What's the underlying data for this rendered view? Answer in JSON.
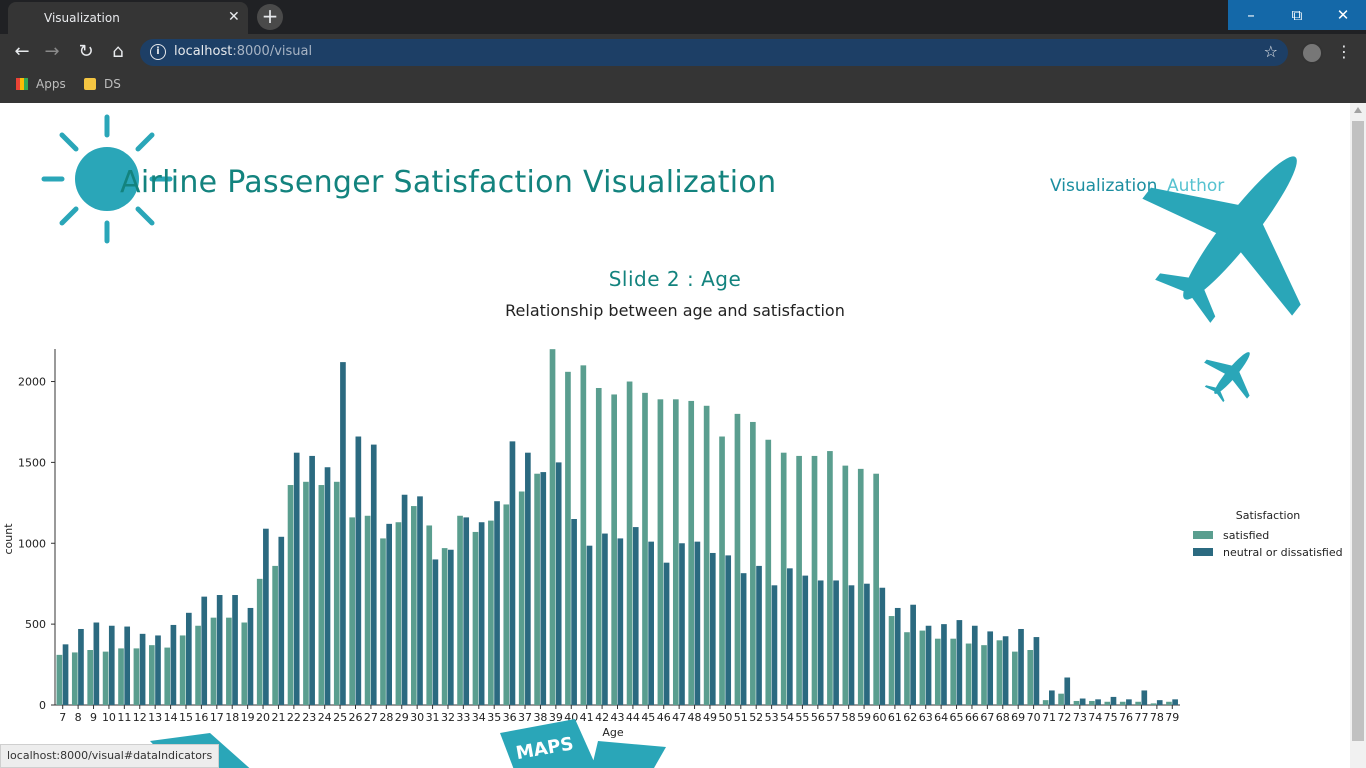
{
  "browser": {
    "tab_title": "Visualization",
    "url_host": "localhost",
    "url_rest": ":8000/visual",
    "bookmarks": [
      "Apps",
      "DS"
    ],
    "status_url": "localhost:8000/visual#dataIndicators"
  },
  "site": {
    "title": "Airline Passenger Satisfaction Visualization",
    "nav": [
      "Visualization",
      "Author"
    ]
  },
  "slide": {
    "title": "Slide 2 : Age",
    "subtitle": "Relationship between age and satisfaction"
  },
  "decor": {
    "bottom_sign": "MAPS"
  },
  "colors": {
    "satisfied": "#5a9e8f",
    "neutral": "#2b6a80",
    "accent": "#13837e",
    "decor": "#2aa6b8"
  },
  "chart_data": {
    "type": "bar",
    "xlabel": "Age",
    "ylabel": "count",
    "ylim": [
      0,
      2300
    ],
    "yticks": [
      0,
      500,
      1000,
      1500,
      2000
    ],
    "legend_title": "Satisfaction",
    "legend_position": "right",
    "categories": [
      "7",
      "8",
      "9",
      "10",
      "11",
      "12",
      "13",
      "14",
      "15",
      "16",
      "17",
      "18",
      "19",
      "20",
      "21",
      "22",
      "23",
      "24",
      "25",
      "26",
      "27",
      "28",
      "29",
      "30",
      "31",
      "32",
      "33",
      "34",
      "35",
      "36",
      "37",
      "38",
      "39",
      "40",
      "41",
      "42",
      "43",
      "44",
      "45",
      "46",
      "47",
      "48",
      "49",
      "50",
      "51",
      "52",
      "53",
      "54",
      "55",
      "56",
      "57",
      "58",
      "59",
      "60",
      "61",
      "62",
      "63",
      "64",
      "65",
      "66",
      "67",
      "68",
      "69",
      "70",
      "71",
      "72",
      "73",
      "74",
      "75",
      "76",
      "77",
      "78",
      "79"
    ],
    "series": [
      {
        "name": "satisfied",
        "values": [
          310,
          325,
          340,
          330,
          350,
          350,
          370,
          355,
          430,
          490,
          540,
          540,
          510,
          780,
          860,
          1360,
          1380,
          1360,
          1380,
          1160,
          1170,
          1030,
          1130,
          1230,
          1110,
          970,
          1170,
          1070,
          1140,
          1240,
          1320,
          1430,
          2200,
          2060,
          2100,
          1960,
          1920,
          2000,
          1930,
          1890,
          1890,
          1880,
          1850,
          1660,
          1800,
          1750,
          1640,
          1560,
          1540,
          1540,
          1570,
          1480,
          1460,
          1430,
          550,
          450,
          460,
          410,
          410,
          380,
          370,
          400,
          330,
          340,
          30,
          70,
          25,
          25,
          20,
          20,
          20,
          10,
          20
        ]
      },
      {
        "name": "neutral or dissatisfied",
        "values": [
          375,
          470,
          510,
          490,
          485,
          440,
          430,
          495,
          570,
          670,
          680,
          680,
          600,
          1090,
          1040,
          1560,
          1540,
          1470,
          2120,
          1660,
          1610,
          1120,
          1300,
          1290,
          900,
          960,
          1160,
          1130,
          1260,
          1630,
          1560,
          1440,
          1500,
          1150,
          985,
          1060,
          1030,
          1100,
          1010,
          880,
          1000,
          1010,
          940,
          925,
          815,
          860,
          740,
          845,
          800,
          770,
          770,
          740,
          750,
          725,
          600,
          620,
          490,
          500,
          525,
          490,
          455,
          425,
          470,
          420,
          90,
          170,
          40,
          35,
          50,
          35,
          90,
          30,
          35
        ]
      }
    ]
  }
}
